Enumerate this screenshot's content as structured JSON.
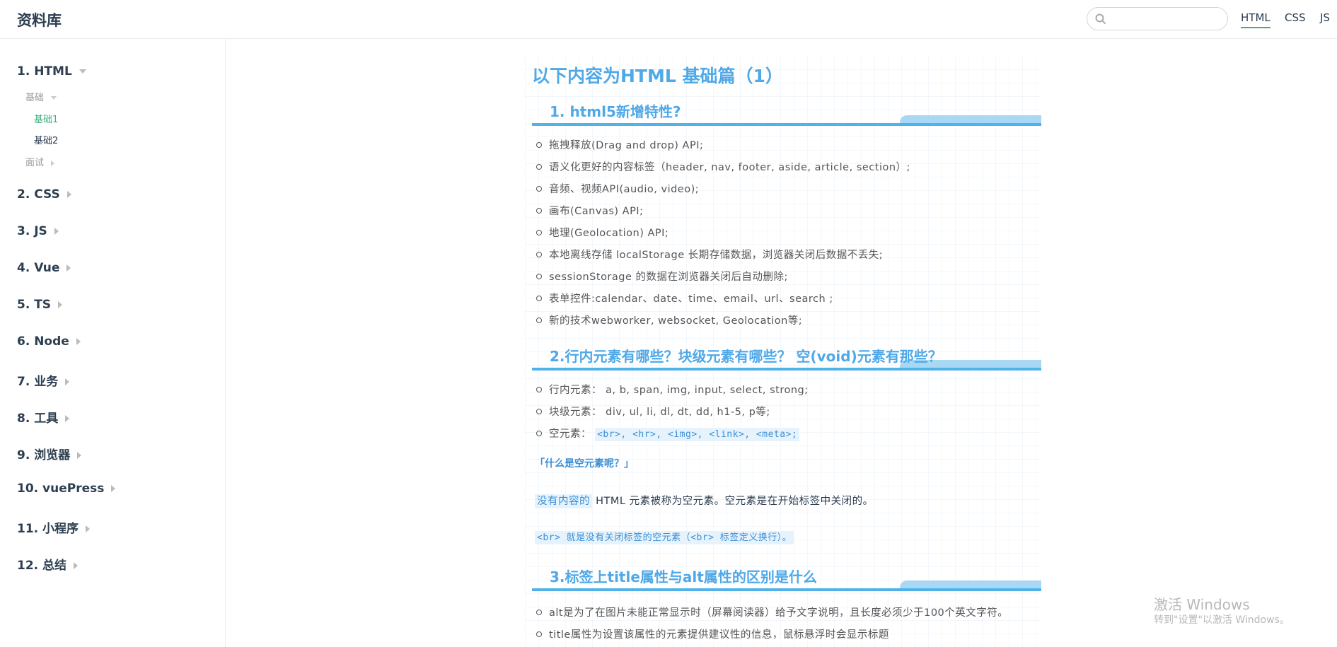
{
  "navbar": {
    "site_name": "资料库",
    "search_placeholder": "",
    "links": [
      "HTML",
      "CSS",
      "JS"
    ]
  },
  "sidebar": {
    "groups": [
      {
        "label": "1. HTML",
        "expanded": true
      },
      {
        "label": "2. CSS"
      },
      {
        "label": "3. JS"
      },
      {
        "label": "4. Vue"
      },
      {
        "label": "5. TS"
      },
      {
        "label": "6. Node"
      },
      {
        "label": "7. 业务"
      },
      {
        "label": "8. 工具"
      },
      {
        "label": "9. 浏览器"
      },
      {
        "label": "10. vuePress"
      },
      {
        "label": "11. 小程序"
      },
      {
        "label": "12. 总结"
      }
    ],
    "html_sub": {
      "basics": "基础",
      "basics_items": [
        "基础1",
        "基础2"
      ],
      "interview": "面试"
    }
  },
  "content": {
    "title": "以下内容为HTML 基础篇（1）",
    "sections": [
      {
        "heading": "1. html5新增特性?",
        "items": [
          "拖拽释放(Drag and drop) API;",
          "语义化更好的内容标签（header, nav, footer, aside, article, section）;",
          "音频、视频API(audio, video);",
          "画布(Canvas) API;",
          "地理(Geolocation) API;",
          "本地离线存储 localStorage 长期存储数据，浏览器关闭后数据不丢失;",
          "sessionStorage 的数据在浏览器关闭后自动删除;",
          "表单控件:calendar、date、time、email、url、search ;",
          "新的技术webworker, websocket, Geolocation等;"
        ]
      },
      {
        "heading": "2.行内元素有哪些？块级元素有哪些？ 空(void)元素有那些？",
        "items": [
          "行内元素： a, b, span, img, input, select, strong;",
          "块级元素： div, ul, li, dl, dt, dd, h1-5, p等;"
        ],
        "void_label": "空元素：",
        "void_code": "<br>, <hr>, <img>, <link>, <meta>;",
        "quote": "「什么是空元素呢？」",
        "para_hl": "没有内容的",
        "para_rest": " HTML 元素被称为空元素。空元素是在开始标签中关闭的。",
        "br_line": "<br> 就是没有关闭标签的空元素（<br> 标签定义换行）。"
      },
      {
        "heading": "3.标签上title属性与alt属性的区别是什么",
        "items": [
          "alt是为了在图片未能正常显示时（屏幕阅读器）给予文字说明，且长度必须少于100个英文字符。",
          "title属性为设置该属性的元素提供建议性的信息，鼠标悬浮时会显示标题"
        ]
      }
    ]
  },
  "watermark": {
    "line1": "激活 Windows",
    "line2": "转到\"设置\"以激活 Windows。"
  }
}
